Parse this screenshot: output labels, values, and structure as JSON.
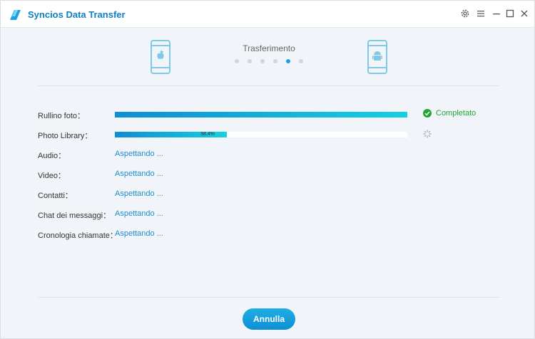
{
  "window": {
    "title": "Syncios Data Transfer",
    "controls": {
      "settings": "gear-icon",
      "menu": "menu-icon",
      "minimize": "minimize-icon",
      "maximize": "maximize-icon",
      "close": "close-icon"
    }
  },
  "header": {
    "title": "Trasferimento",
    "source_device": "iphone-icon",
    "target_device": "android-icon",
    "steps_total": 6,
    "steps_active": 5
  },
  "rows": [
    {
      "label": "Rullino foto：",
      "state": "done",
      "progress": 1.0,
      "status": "Completato"
    },
    {
      "label": "Photo Library：",
      "state": "progress",
      "progress": 0.384,
      "progress_text": "38.4%"
    },
    {
      "label": "Audio：",
      "state": "waiting",
      "status": "Aspettando ..."
    },
    {
      "label": "Video：",
      "state": "waiting",
      "status": "Aspettando ..."
    },
    {
      "label": "Contatti：",
      "state": "waiting",
      "status": "Aspettando ..."
    },
    {
      "label": "Chat dei messaggi：",
      "state": "waiting",
      "status": "Aspettando ..."
    },
    {
      "label": "Cronologia chiamate：",
      "state": "waiting",
      "status": "Aspettando ..."
    }
  ],
  "footer": {
    "cancel_label": "Annulla"
  },
  "colors": {
    "accent": "#1aa3e0",
    "success": "#22a535",
    "title": "#0e7fc4"
  }
}
